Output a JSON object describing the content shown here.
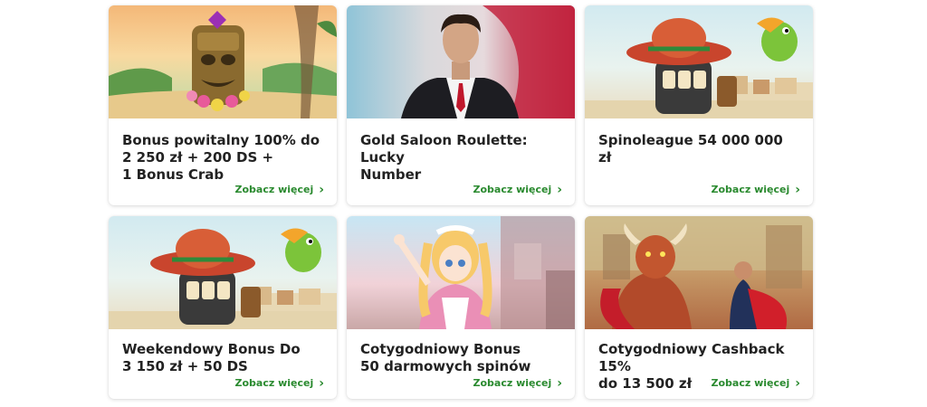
{
  "promotions": [
    {
      "title_lines": [
        "Bonus powitalny 100% do",
        "2 250 zł + 200 DS +",
        "1 Bonus Crab"
      ],
      "link": "Zobacz więcej",
      "image": "tiki-mask-scene"
    },
    {
      "title_lines": [
        "Gold Saloon Roulette: Lucky",
        "Number"
      ],
      "link": "Zobacz więcej",
      "image": "roulette-dealer"
    },
    {
      "title_lines": [
        "Spinoleague 54 000 000 zł"
      ],
      "link": "Zobacz więcej",
      "image": "sombrero-slot-scene"
    },
    {
      "title_lines": [
        "Weekendowy Bonus Do",
        "3 150 zł + 50 DS"
      ],
      "link": "Zobacz więcej",
      "image": "sombrero-slot-scene"
    },
    {
      "title_lines": [
        "Cotygodniowy Bonus",
        "50 darmowych spinów"
      ],
      "link": "Zobacz więcej",
      "image": "anime-girl-scene"
    },
    {
      "title_lines": [
        "Cotygodniowy Cashback 15%",
        "do 13 500 zł"
      ],
      "link": "Zobacz więcej",
      "image": "bull-matador-scene"
    }
  ],
  "colors": {
    "link": "#2a8a2f",
    "title": "#222222"
  }
}
